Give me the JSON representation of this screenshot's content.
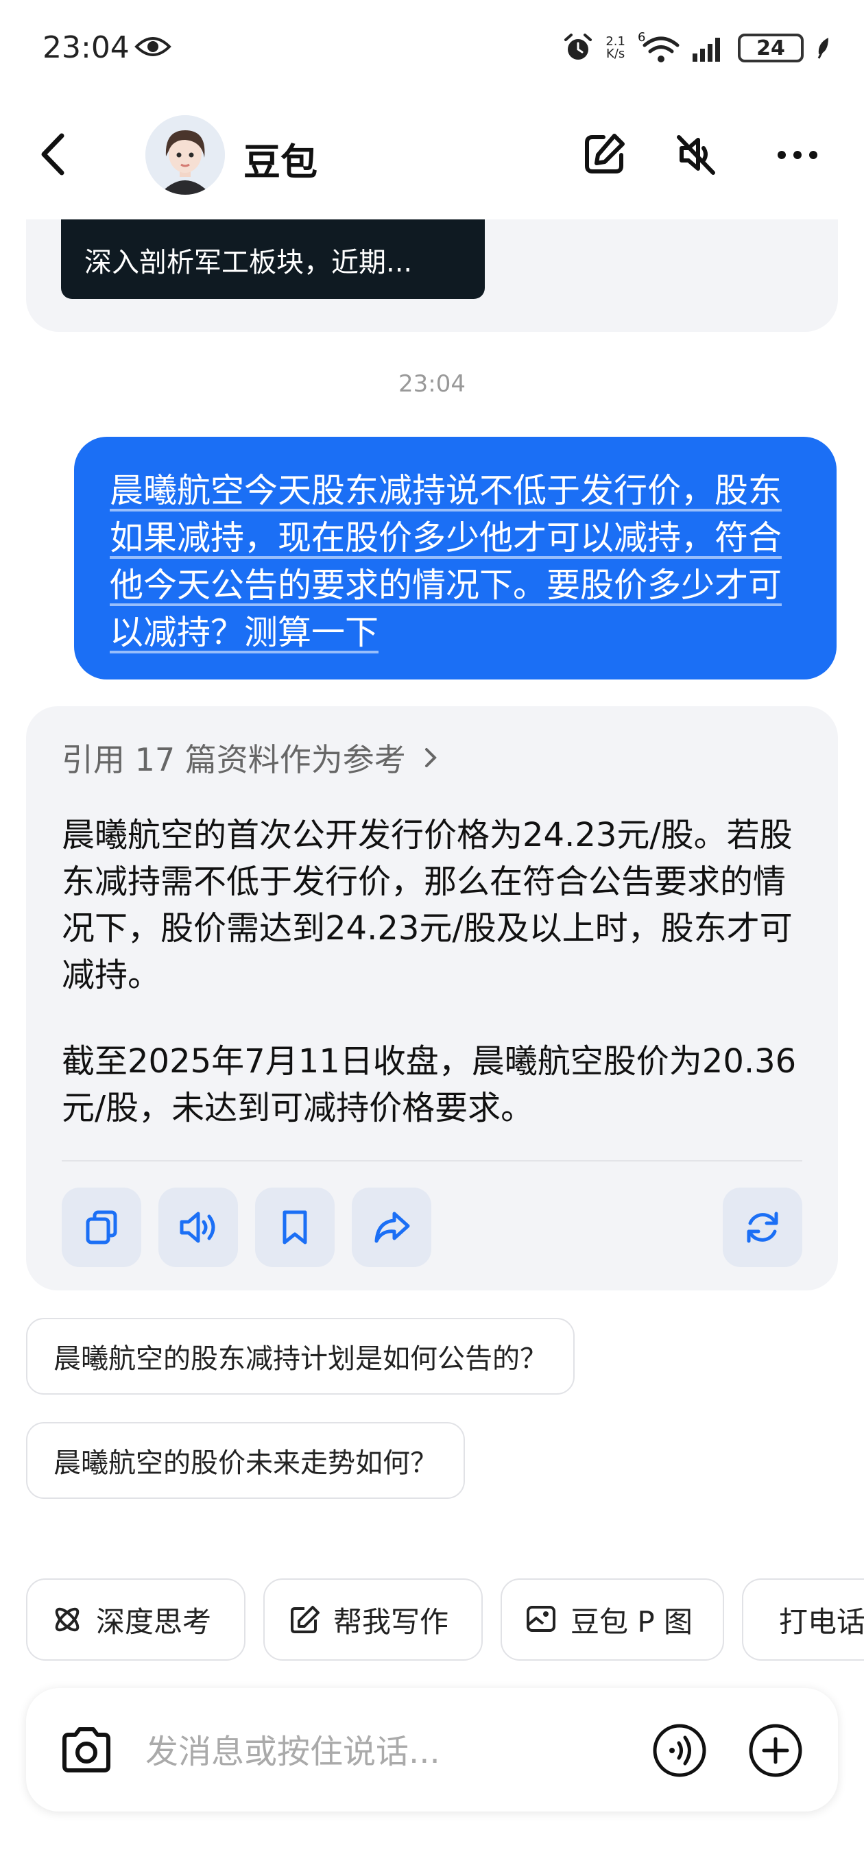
{
  "status_bar": {
    "time": "23:04",
    "net_speed_value": "2.1",
    "net_speed_unit": "K/s",
    "network_gen": "6",
    "battery": "24"
  },
  "header": {
    "title": "豆包"
  },
  "previous_message": {
    "thumbnail_text": "深入剖析军工板块，近期..."
  },
  "timestamp": "23:04",
  "user_message": {
    "text": "晨曦航空今天股东减持说不低于发行价，股东如果减持，现在股价多少他才可以减持，符合他今天公告的要求的情况下。要股价多少才可以减持？测算一下"
  },
  "answer": {
    "reference_label": "引用 17 篇资料作为参考",
    "paragraph_1": "晨曦航空的首次公开发行价格为24.23元/股。若股东减持需不低于发行价，那么在符合公告要求的情况下，股价需达到24.23元/股及以上时，股东才可减持。",
    "paragraph_2": "截至2025年7月11日收盘，晨曦航空股价为20.36元/股，未达到可减持价格要求。"
  },
  "suggestions": [
    "晨曦航空的股东减持计划是如何公告的？",
    "晨曦航空的股价未来走势如何？"
  ],
  "quick_actions": [
    {
      "label": "深度思考",
      "icon": "atom-icon"
    },
    {
      "label": "帮我写作",
      "icon": "edit-icon"
    },
    {
      "label": "豆包 P 图",
      "icon": "image-edit-icon"
    },
    {
      "label": "打电话",
      "icon": "phone-icon"
    }
  ],
  "input": {
    "placeholder": "发消息或按住说话..."
  },
  "colors": {
    "accent": "#1b6ff5",
    "bubble_bg": "#f3f4f7",
    "icon_blue": "#1b6ff5"
  }
}
